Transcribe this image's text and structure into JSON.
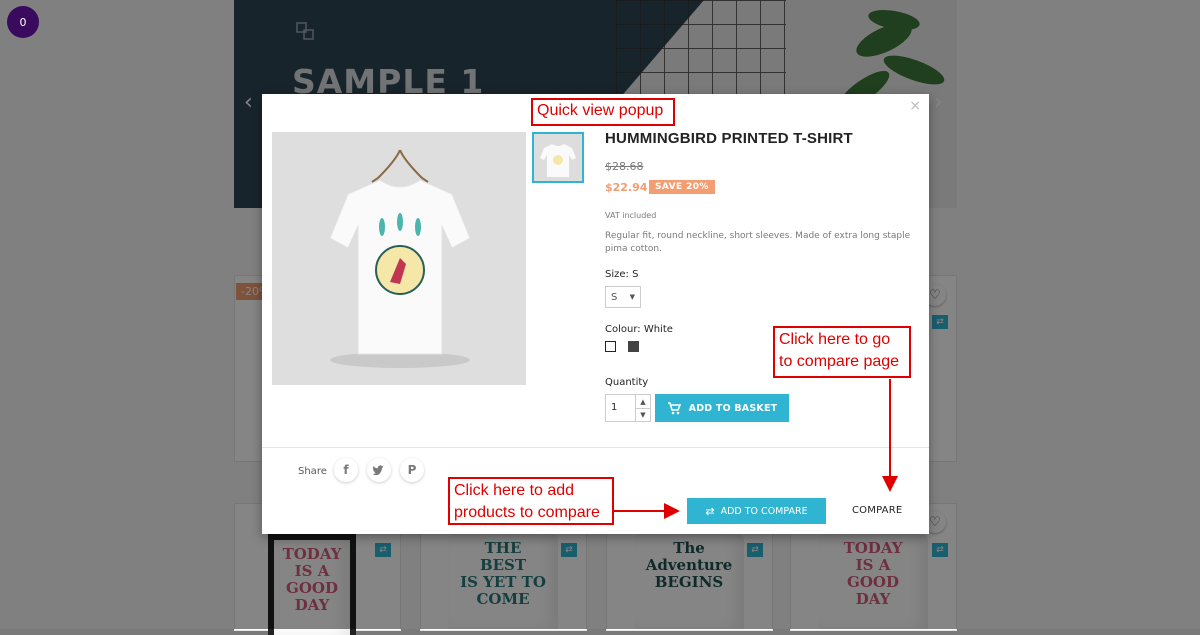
{
  "notification_badge": "0",
  "background": {
    "hero_title": "SAMPLE 1",
    "sale_tag": "-20%",
    "mugs": [
      {
        "lines": [
          "TODAY",
          "IS A",
          "GOOD",
          "DAY"
        ],
        "color": "#d45b7a"
      },
      {
        "lines": [
          "THE",
          "BEST",
          "IS YET TO",
          "COME"
        ],
        "color": "#2a7a7a"
      },
      {
        "lines": [
          "The",
          "Adventure",
          "BEGINS"
        ],
        "color": "#1f4f4f"
      },
      {
        "lines": [
          "TODAY",
          "IS A",
          "GOOD",
          "DAY"
        ],
        "color": "#d45b7a"
      }
    ]
  },
  "modal": {
    "close": "×",
    "title": "HUMMINGBIRD PRINTED T-SHIRT",
    "old_price": "$28.68",
    "price": "$22.94",
    "discount": "SAVE 20%",
    "tax_note": "VAT included",
    "description": "Regular fit, round neckline, short sleeves. Made of extra long staple pima cotton.",
    "size_label": "Size: S",
    "size_value": "S",
    "colour_label": "Colour: White",
    "colours": [
      "#ffffff",
      "#434343"
    ],
    "quantity_label": "Quantity",
    "quantity_value": "1",
    "add_to_basket": "ADD TO BASKET",
    "share_label": "Share",
    "social_icons": [
      "facebook-icon",
      "twitter-icon",
      "pinterest-icon"
    ],
    "add_to_compare": "ADD TO COMPARE",
    "compare_link": "COMPARE"
  },
  "annotations": {
    "quick_view": "Quick view popup",
    "compare_page_line1": "Click here to go",
    "compare_page_line2": "to compare page",
    "add_products_line1": "Click here to add",
    "add_products_line2": "products to compare"
  },
  "colors": {
    "accent": "#2fb5d2",
    "price": "#f39d72",
    "annotation": "#e00000"
  }
}
